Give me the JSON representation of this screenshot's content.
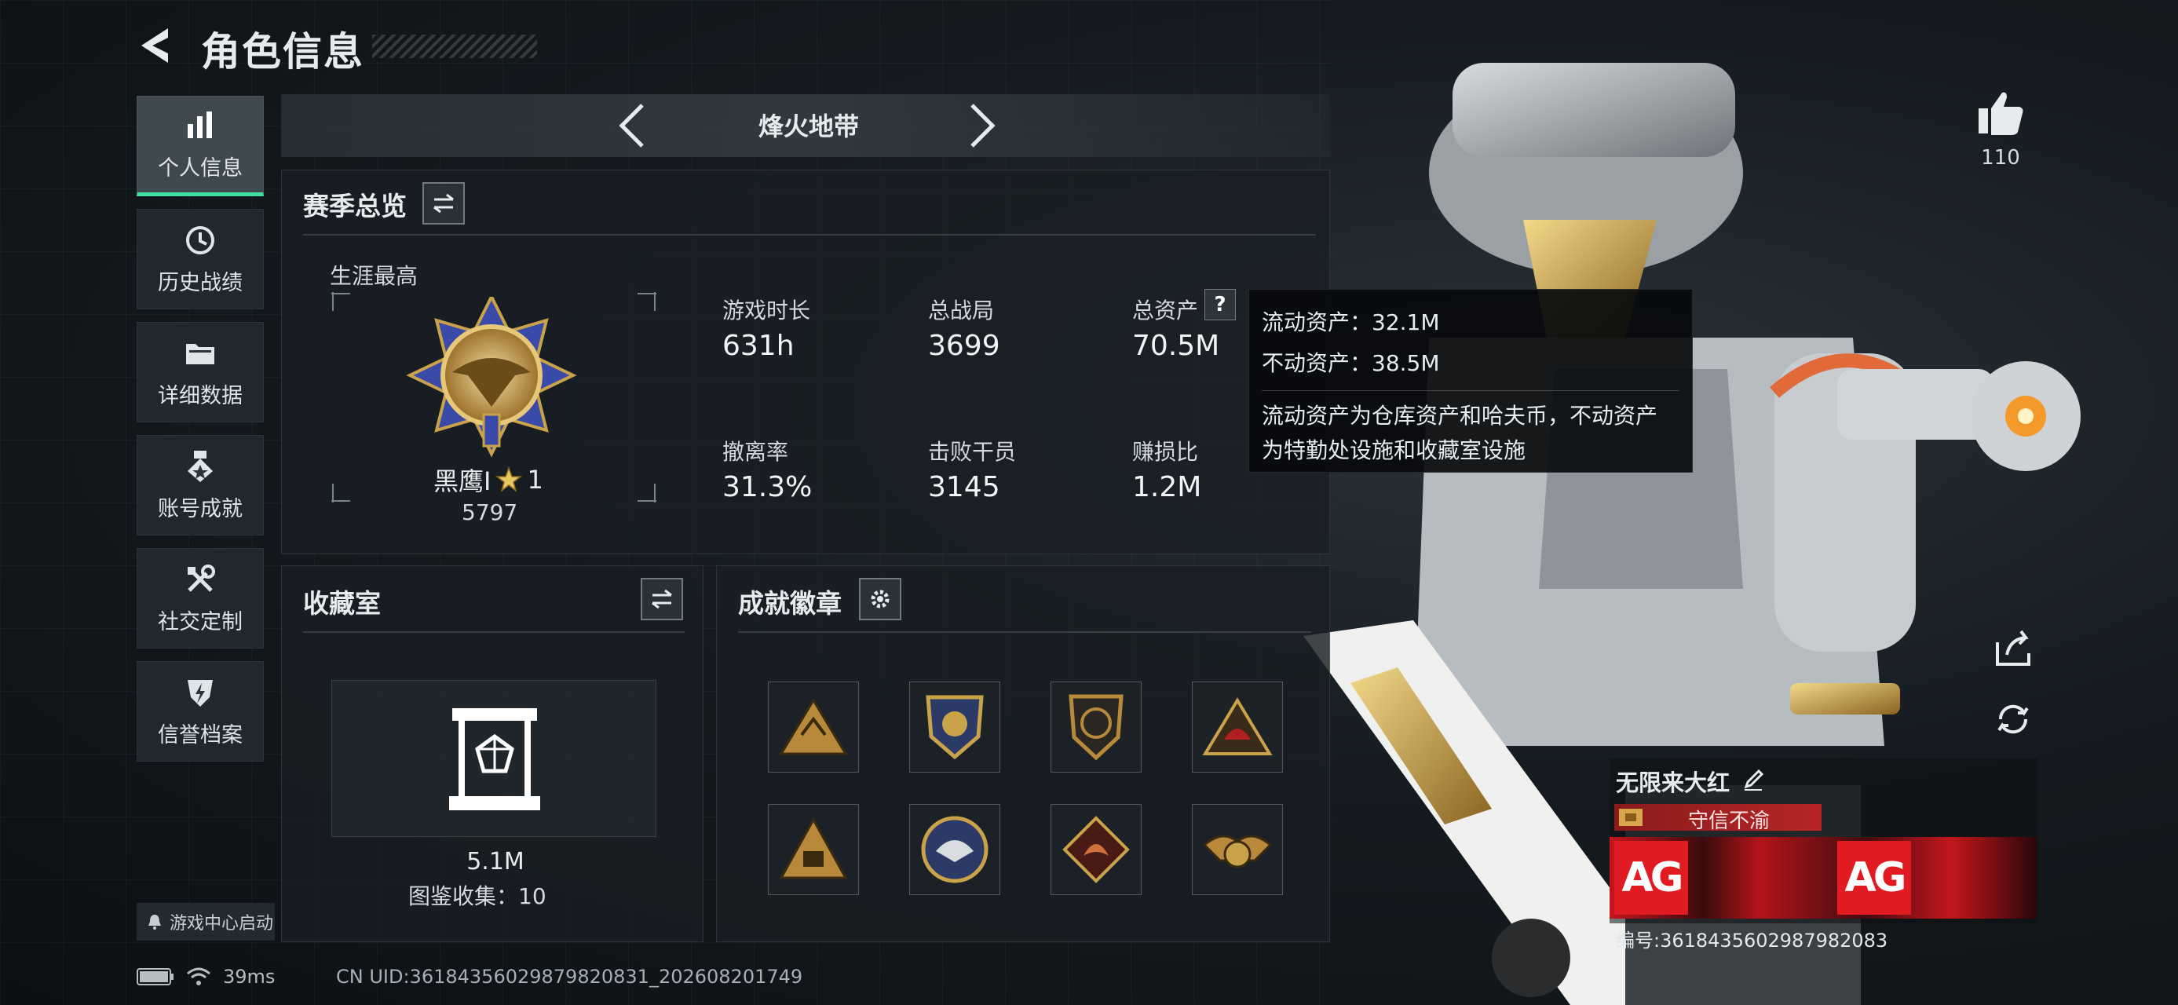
{
  "header": {
    "title": "角色信息"
  },
  "nav": {
    "items": [
      {
        "label": "个人信息",
        "icon": "bar-chart-icon",
        "active": true
      },
      {
        "label": "历史战绩",
        "icon": "history-clock-icon",
        "active": false
      },
      {
        "label": "详细数据",
        "icon": "folder-icon",
        "active": false
      },
      {
        "label": "账号成就",
        "icon": "achievement-medal-icon",
        "active": false
      },
      {
        "label": "社交定制",
        "icon": "tools-icon",
        "active": false
      },
      {
        "label": "信誉档案",
        "icon": "shield-badge-icon",
        "active": false
      }
    ],
    "game_center": "游戏中心启动"
  },
  "mode": {
    "title": "烽火地带"
  },
  "season": {
    "title": "赛季总览",
    "career_best_label": "生涯最高",
    "rank_name": "黑鹰Ⅰ",
    "rank_stars": "1",
    "rank_points": "5797",
    "stats": [
      {
        "label": "游戏时长",
        "value": "631h"
      },
      {
        "label": "总战局",
        "value": "3699"
      },
      {
        "label": "总资产",
        "value": "70.5M"
      },
      {
        "label": "撤离率",
        "value": "31.3%"
      },
      {
        "label": "击败干员",
        "value": "3145"
      },
      {
        "label": "赚损比",
        "value": "1.2M"
      }
    ]
  },
  "tooltip": {
    "liquid": "流动资产：32.1M",
    "fixed": "不动资产：38.5M",
    "desc_line1": "流动资产为仓库资产和哈夫币，不动资产",
    "desc_line2": "为特勤处设施和收藏室设施"
  },
  "collection": {
    "title": "收藏室",
    "value": "5.1M",
    "catalog": "图鉴收集：10"
  },
  "badges": {
    "title": "成就徽章",
    "items": [
      "badge-1",
      "badge-2",
      "badge-3",
      "badge-4",
      "badge-5",
      "badge-6",
      "badge-7",
      "badge-8"
    ]
  },
  "right": {
    "likes": "110",
    "player_name": "无限来大红",
    "reputation": "守信不渝",
    "team_logo_text": "AG",
    "serial": "编号:3618435602987982083"
  },
  "status": {
    "ping": "39ms",
    "uid": "CN UID:3618435602987982083​1_202608201749"
  },
  "colors": {
    "accent": "#3fe0a2",
    "red": "#c4161c",
    "gold": "#c9a24a"
  }
}
